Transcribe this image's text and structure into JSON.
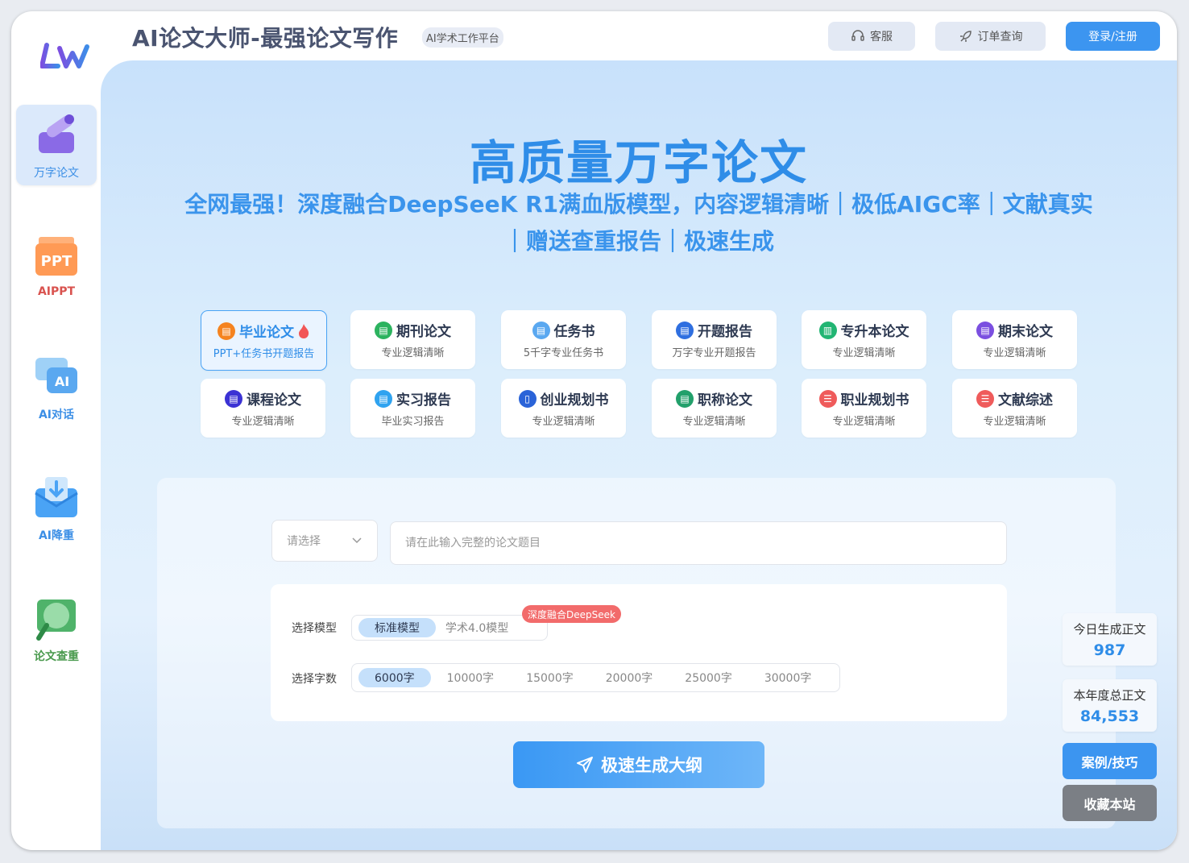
{
  "header": {
    "title": "AI论文大师-最强论文写作",
    "subtitle": "AI学术工作平台",
    "service_label": "客服",
    "order_label": "订单查询",
    "login_label": "登录/注册"
  },
  "sidebar": {
    "items": [
      {
        "label": "万字论文",
        "icon": "pen-icon",
        "color": "#3c8fe6"
      },
      {
        "label": "AIPPT",
        "icon": "ppt-icon",
        "color": "#d9534f"
      },
      {
        "label": "AI对话",
        "icon": "chat-icon",
        "color": "#3c8fe6"
      },
      {
        "label": "AI降重",
        "icon": "download-icon",
        "color": "#3c8fe6"
      },
      {
        "label": "论文查重",
        "icon": "magnifier-icon",
        "color": "#4a9a4e"
      }
    ]
  },
  "hero": {
    "title": "高质量万字论文",
    "subtitle_line1": "全网最强！深度融合DeepSeeK R1满血版模型，内容逻辑清晰｜极低AIGC率｜文献真实",
    "subtitle_line2": "｜赠送查重报告｜极速生成"
  },
  "cards": [
    {
      "title": "毕业论文",
      "desc": "PPT+任务书开题报告",
      "color": "#f5831f"
    },
    {
      "title": "期刊论文",
      "desc": "专业逻辑清晰",
      "color": "#2cb35f"
    },
    {
      "title": "任务书",
      "desc": "5千字专业任务书",
      "color": "#5aa8f0"
    },
    {
      "title": "开题报告",
      "desc": "万字专业开题报告",
      "color": "#2f6fe0"
    },
    {
      "title": "专升本论文",
      "desc": "专业逻辑清晰",
      "color": "#22b573"
    },
    {
      "title": "期末论文",
      "desc": "专业逻辑清晰",
      "color": "#7b4fe0"
    },
    {
      "title": "课程论文",
      "desc": "专业逻辑清晰",
      "color": "#3b32d4"
    },
    {
      "title": "实习报告",
      "desc": "毕业实习报告",
      "color": "#2fa3f0"
    },
    {
      "title": "创业规划书",
      "desc": "专业逻辑清晰",
      "color": "#2a63d8"
    },
    {
      "title": "职称论文",
      "desc": "专业逻辑清晰",
      "color": "#22a06b"
    },
    {
      "title": "职业规划书",
      "desc": "专业逻辑清晰",
      "color": "#ef5b5b"
    },
    {
      "title": "文献综述",
      "desc": "专业逻辑清晰",
      "color": "#ef5b5b"
    }
  ],
  "form": {
    "select_placeholder": "请选择",
    "topic_placeholder": "请在此输入完整的论文题目",
    "model_label": "选择模型",
    "models": [
      "标准模型",
      "学术4.0模型"
    ],
    "model_badge": "深度融合DeepSeek",
    "words_label": "选择字数",
    "word_options": [
      "6000字",
      "10000字",
      "15000字",
      "20000字",
      "25000字",
      "30000字"
    ],
    "generate_label": "极速生成大纲"
  },
  "stats": {
    "today_label": "今日生成正文",
    "today_value": "987",
    "year_label": "本年度总正文",
    "year_value": "84,553"
  },
  "side": {
    "cases_label": "案例/技巧",
    "bookmark_label": "收藏本站"
  }
}
